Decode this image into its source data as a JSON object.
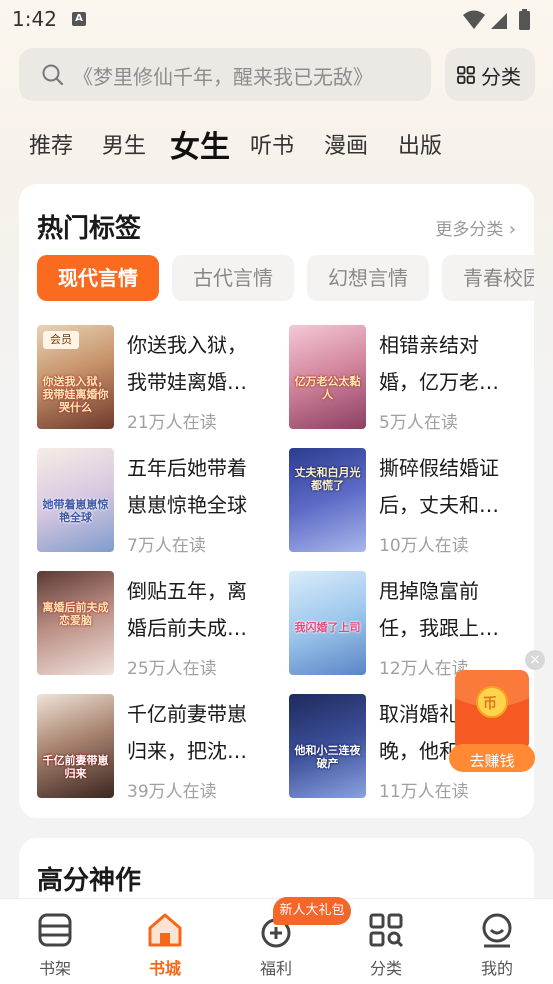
{
  "status_bar": {
    "time": "1:42",
    "notification_letter": "A"
  },
  "search": {
    "placeholder": "《梦里修仙千年，醒来我已无敌》"
  },
  "category_button": {
    "label": "分类"
  },
  "tabs": [
    {
      "label": "推荐"
    },
    {
      "label": "男生"
    },
    {
      "label": "女生",
      "active": true
    },
    {
      "label": "听书"
    },
    {
      "label": "漫画"
    },
    {
      "label": "出版"
    }
  ],
  "hot_tags": {
    "title": "热门标签",
    "more": "更多分类",
    "tags": [
      "现代言情",
      "古代言情",
      "幻想言情",
      "青春校园"
    ],
    "books": [
      {
        "title_line1": "你送我入狱，",
        "title_line2": "我带娃离婚…",
        "readers": "21万人在读",
        "badge": "会员",
        "cover_title": "你送我入狱，我带娃离婚你哭什么"
      },
      {
        "title_line1": "相错亲结对",
        "title_line2": "婚，亿万老…",
        "readers": "5万人在读",
        "cover_title": "亿万老公太黏人"
      },
      {
        "title_line1": "五年后她带着",
        "title_line2": "崽崽惊艳全球",
        "readers": "7万人在读",
        "cover_title": "她带着崽崽惊艳全球"
      },
      {
        "title_line1": "撕碎假结婚证",
        "title_line2": "后，丈夫和…",
        "readers": "10万人在读",
        "cover_title": "丈夫和白月光都慌了"
      },
      {
        "title_line1": "倒贴五年，离",
        "title_line2": "婚后前夫成…",
        "readers": "25万人在读",
        "cover_title": "离婚后前夫成恋爱脑"
      },
      {
        "title_line1": "甩掉隐富前",
        "title_line2": "任，我跟上…",
        "readers": "12万人在读",
        "cover_title": "我闪婚了上司"
      },
      {
        "title_line1": "千亿前妻带崽",
        "title_line2": "归来，把沈…",
        "readers": "39万人在读",
        "cover_title": "千亿前妻带崽归来"
      },
      {
        "title_line1": "取消婚礼",
        "title_line2": "晚，他和",
        "readers": "11万人在读",
        "cover_title": "他和小三连夜破产"
      }
    ]
  },
  "high_score": {
    "title": "高分神作"
  },
  "float_reward": {
    "label": "去赚钱",
    "coin_symbol": "币"
  },
  "bottom_nav": {
    "gift_badge": "新人大礼包",
    "items": [
      {
        "label": "书架"
      },
      {
        "label": "书城",
        "active": true
      },
      {
        "label": "福利"
      },
      {
        "label": "分类"
      },
      {
        "label": "我的"
      }
    ]
  },
  "colors": {
    "accent": "#fa6a1f",
    "nav_active": "#f7671a"
  }
}
